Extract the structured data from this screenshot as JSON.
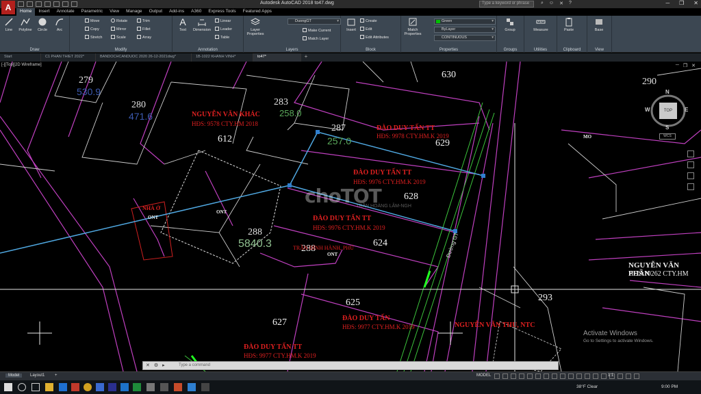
{
  "window": {
    "title": "Autodesk AutoCAD 2018    to47.dwg",
    "search_placeholder": "Type a keyword or phrase",
    "app_logo": "A"
  },
  "ribbon_tabs": [
    "Home",
    "Insert",
    "Annotate",
    "Parametric",
    "View",
    "Manage",
    "Output",
    "Add-ins",
    "A360",
    "Express Tools",
    "Featured Apps"
  ],
  "panels": {
    "draw": {
      "title": "Draw",
      "tools": [
        "Line",
        "Polyline",
        "Circle",
        "Arc"
      ]
    },
    "modify": {
      "title": "Modify",
      "tools": [
        "Move",
        "Rotate",
        "Trim",
        "Copy",
        "Mirror",
        "Fillet",
        "Stretch",
        "Scale",
        "Array"
      ]
    },
    "annotation": {
      "title": "Annotation",
      "tools": [
        "Text",
        "Dimension",
        "Linear",
        "Leader",
        "Table"
      ]
    },
    "layers": {
      "title": "Layers",
      "big_tool": "Layer Properties",
      "current_layer": "DuongGT",
      "tools": [
        "Make Current",
        "Match Layer"
      ]
    },
    "block": {
      "title": "Block",
      "big_tool": "Insert",
      "tools": [
        "Create",
        "Edit",
        "Edit Attributes"
      ]
    },
    "properties": {
      "title": "Properties",
      "big_tool": "Match Properties",
      "color": "Green",
      "linetype": "ByLayer",
      "lineweight": "CONTINUOUS",
      "color_hex": "#00c000"
    },
    "groups": {
      "title": "Groups",
      "big_tool": "Group"
    },
    "utilities": {
      "title": "Utilities",
      "big_tool": "Measure"
    },
    "clipboard": {
      "title": "Clipboard",
      "big_tool": "Paste"
    },
    "view": {
      "title": "View",
      "big_tool": "Base"
    }
  },
  "file_tabs": [
    "Start",
    "C1 PHAN THIET 2022*",
    "BANDOCHCANDUOC 2020 26-12-2021dwg*",
    "1B-1022 KHANH VINH*",
    "to47*"
  ],
  "viewport": {
    "label": "[-][Top][2D Wireframe]",
    "viewcube_face": "TOP",
    "compass": {
      "n": "N",
      "s": "S",
      "e": "E",
      "w": "W"
    },
    "wcs": "WCS"
  },
  "drawing_text": {
    "lot_numbers": [
      "630",
      "279",
      "280",
      "283",
      "287",
      "612",
      "629",
      "628",
      "288",
      "624",
      "625",
      "627",
      "293",
      "290",
      "288"
    ],
    "owners": [
      "NGUYỄN VĂN KHÁC",
      "HĐS: 9578 CTY.HM 2018",
      "ĐÀO DUY TẤN    TT",
      "HĐS: 9978 CTY.HM.K 2019",
      "ĐÀO DUY TẤN    TT",
      "HĐS: 9976 CTY.HM.K 2019",
      "ĐÀO DUY TẤN    TT",
      "HĐS: 9976 CTY.HM.K 2019",
      "ĐÀO DUY TẤN",
      "HĐS: 9977 CTY.HM.K 2019",
      "ĐÀO DUY TẤN    TT",
      "HĐS: 9977 CTY.HM.K 2019",
      "NGUYỄN VĂN THU, NTC",
      "NGUYỄN VĂN PHẦN",
      "HĐS:10262  CTY.HM",
      "TRẦN ĐÌNH HÀNH, PHÚ"
    ],
    "areas": [
      "5840.3",
      "257.0",
      "258.0",
      "530.9",
      "471.6"
    ],
    "land_codes": [
      "ONT",
      "ONT",
      "ONT",
      "MO",
      "NHÀ Ở"
    ],
    "road_label": "Đường GT"
  },
  "watermark": {
    "main": "choTOT",
    "sub": "TRẦN HOÀNG LÂM-NGH"
  },
  "activate_windows": {
    "title": "Activate Windows",
    "subtitle": "Go to Settings to activate Windows."
  },
  "command_line": {
    "placeholder": "Type a command"
  },
  "layout_tabs": [
    "Model",
    "Layout1"
  ],
  "status": {
    "model": "MODEL",
    "scale": "1:1"
  },
  "taskbar": {
    "weather": "38°F  Clear",
    "time": "9:00 PM"
  }
}
